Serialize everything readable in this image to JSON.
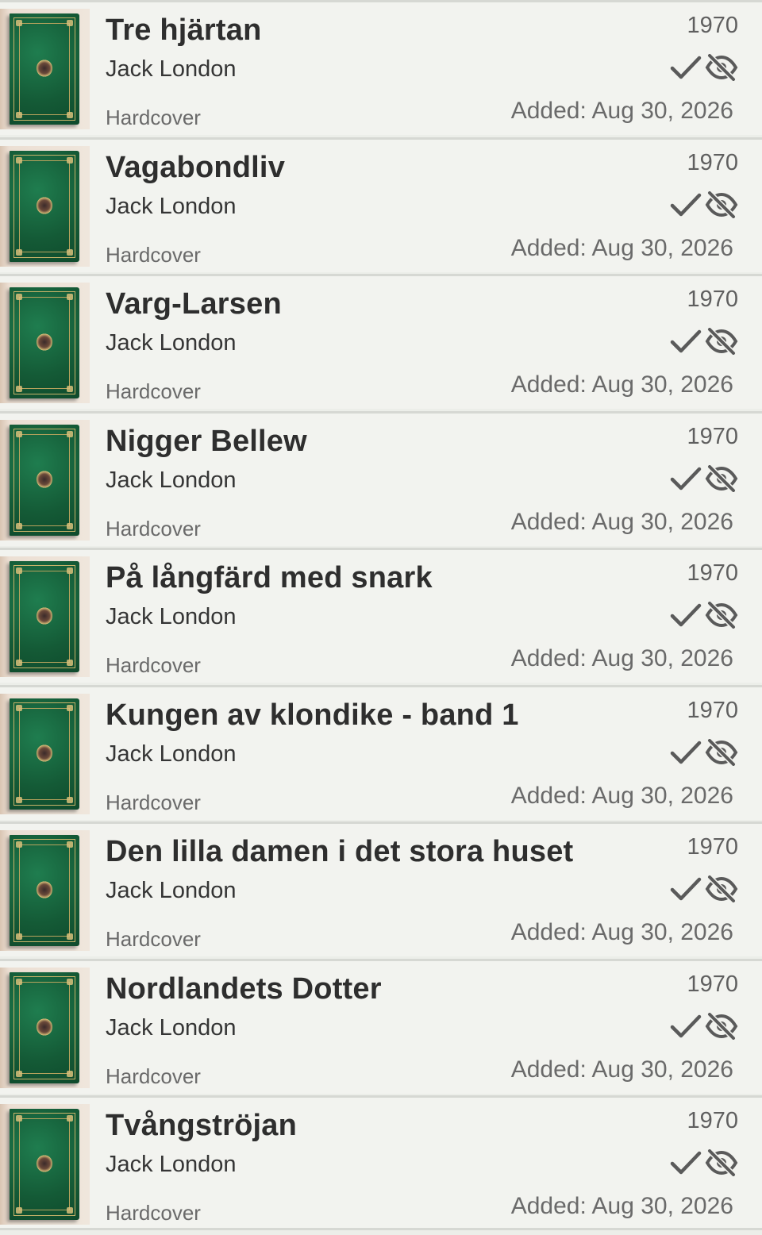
{
  "books": [
    {
      "title": "Tre hjärtan",
      "author": "Jack London",
      "format": "Hardcover",
      "year": "1970",
      "added": "Added: Aug 30, 2026"
    },
    {
      "title": "Vagabondliv",
      "author": "Jack London",
      "format": "Hardcover",
      "year": "1970",
      "added": "Added: Aug 30, 2026"
    },
    {
      "title": "Varg-Larsen",
      "author": "Jack London",
      "format": "Hardcover",
      "year": "1970",
      "added": "Added: Aug 30, 2026"
    },
    {
      "title": "Nigger Bellew",
      "author": "Jack London",
      "format": "Hardcover",
      "year": "1970",
      "added": "Added: Aug 30, 2026"
    },
    {
      "title": "På långfärd med snark",
      "author": "Jack London",
      "format": "Hardcover",
      "year": "1970",
      "added": "Added: Aug 30, 2026"
    },
    {
      "title": "Kungen av klondike - band 1",
      "author": "Jack London",
      "format": "Hardcover",
      "year": "1970",
      "added": "Added: Aug 30, 2026"
    },
    {
      "title": "Den lilla damen i det stora huset",
      "author": "Jack London",
      "format": "Hardcover",
      "year": "1970",
      "added": "Added: Aug 30, 2026"
    },
    {
      "title": "Nordlandets Dotter",
      "author": "Jack London",
      "format": "Hardcover",
      "year": "1970",
      "added": "Added: Aug 30, 2026"
    },
    {
      "title": "Tvångströjan",
      "author": "Jack London",
      "format": "Hardcover",
      "year": "1970",
      "added": "Added: Aug 30, 2026"
    }
  ],
  "icons": {
    "owned": "check-icon",
    "hidden": "eye-off-icon",
    "cover": "book-cover-thumbnail"
  },
  "colors": {
    "background": "#eceee9",
    "row": "#f2f3ef",
    "divider": "#d6d8d3",
    "cover_green": "#145a36",
    "icon": "#5a5a5a"
  }
}
